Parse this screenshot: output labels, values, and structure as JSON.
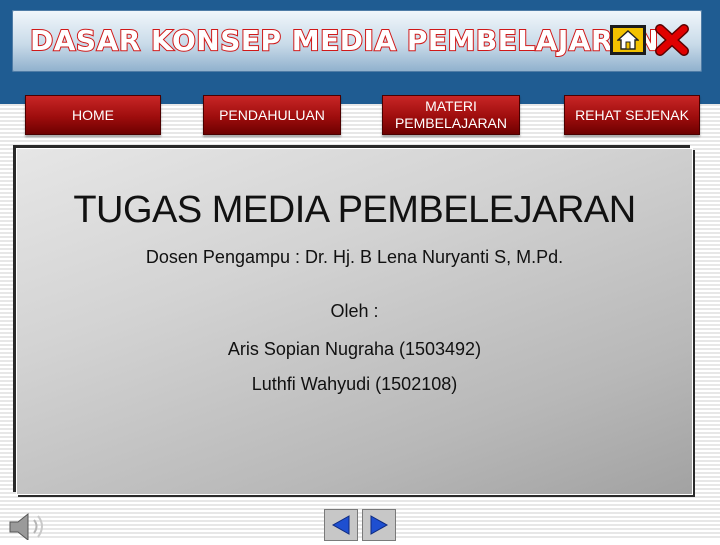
{
  "header": {
    "title": "DASAR KONSEP MEDIA PEMBELAJARAN",
    "home_icon": "home-icon",
    "close_icon": "close-icon",
    "colors": {
      "title_outline": "#d01818",
      "home_icon_bg": "#f2c200",
      "close_icon": "#e00000"
    }
  },
  "nav": {
    "items": [
      {
        "label": "HOME"
      },
      {
        "label": "PENDAHULUAN"
      },
      {
        "label": "MATERI PEMBELAJARAN"
      },
      {
        "label": "REHAT SEJENAK"
      }
    ]
  },
  "content": {
    "title": "TUGAS MEDIA PEMBELEJARAN",
    "dosen": "Dosen Pengampu : Dr. Hj. B Lena Nuryanti S, M.Pd.",
    "oleh": "Oleh :",
    "students": [
      "Aris Sopian Nugraha (1503492)",
      "Luthfi Wahyudi (1502108)"
    ]
  },
  "footer": {
    "speaker_icon": "speaker-icon",
    "prev_icon": "arrow-left-icon",
    "next_icon": "arrow-right-icon",
    "colors": {
      "arrow": "#1e4fd0"
    }
  }
}
